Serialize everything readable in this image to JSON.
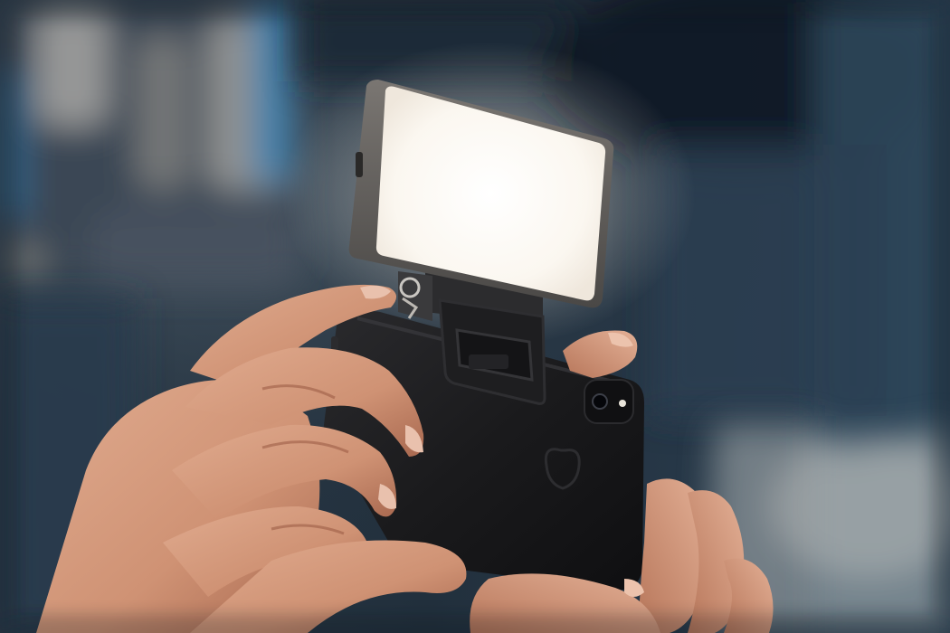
{
  "image": {
    "palette": {
      "background_dark": "#1c2733",
      "background_blue": "#2e4456",
      "bokeh_light": "#d9d4cc",
      "light_panel": "#fbf8f3",
      "light_housing": "#5a5856",
      "phone_case": "#1b1b1d",
      "skin": "#d59a7d",
      "skin_shadow": "#a8684f"
    }
  }
}
